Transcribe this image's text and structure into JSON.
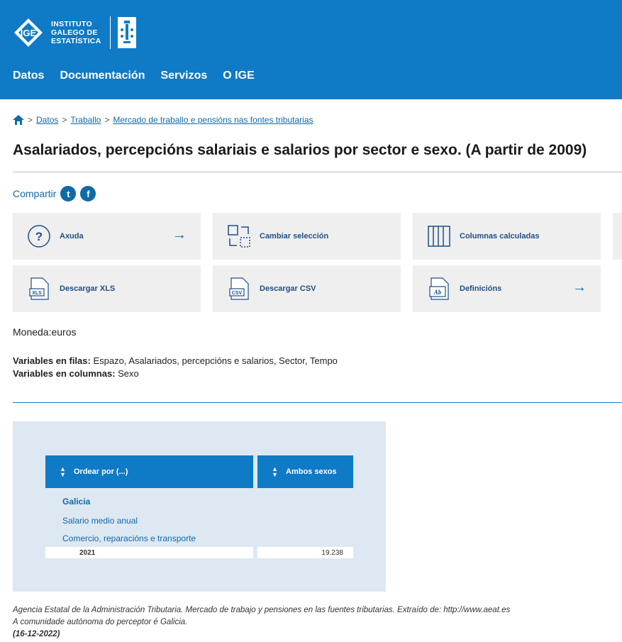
{
  "header": {
    "logo_lines": [
      "INSTITUTO",
      "GALEGO DE",
      "ESTATÍSTICA"
    ],
    "nav": [
      "Datos",
      "Documentación",
      "Servizos",
      "O IGE"
    ]
  },
  "breadcrumb": {
    "sep": ">",
    "items": [
      "Datos",
      "Traballo",
      "Mercado de traballo e pensións nas fontes tributarias"
    ]
  },
  "page_title": "Asalariados, percepcións salariais e salarios por sector e sexo. (A partir de 2009)",
  "share": {
    "label": "Compartir",
    "twitter": "t",
    "facebook": "f"
  },
  "tools": {
    "axuda": "Axuda",
    "cambiar": "Cambiar selección",
    "columnas": "Columnas calculadas",
    "xls": "Descargar XLS",
    "csv": "Descargar CSV",
    "definicions": "Definicións",
    "xls_badge": "XLS",
    "csv_badge": "CSV",
    "ab_badge": "Ab"
  },
  "meta": "Moneda:euros",
  "variables": {
    "rows_label": "Variables en filas:",
    "rows_value": " Espazo, Asalariados, percepcións e salarios, Sector, Tempo",
    "cols_label": "Variables en columnas:",
    "cols_value": " Sexo"
  },
  "table": {
    "col_order": "Ordear por (...)",
    "col_sexes": "Ambos sexos",
    "level1": "Galicia",
    "level2": "Salario medio anual",
    "level3": "Comercio, reparacións e transporte",
    "year": "2021",
    "value": "19.238"
  },
  "footer": {
    "source": "Agencia Estatal de la Administración Tributaria. Mercado de trabajo y pensiones en las fuentes tributarias. Extraído de: http://www.aeat.es",
    "note": "A comunidade autónoma do perceptor é Galicia.",
    "date": "(16-12-2022)"
  },
  "colors": {
    "primary": "#0f7ac6",
    "link": "#0f6aa8",
    "panel": "#dde8f3",
    "tile": "#efefef"
  }
}
